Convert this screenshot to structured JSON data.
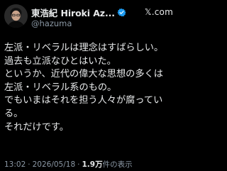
{
  "author": {
    "display_name": "東浩紀 Hiroki Az...",
    "handle": "@hazuma",
    "verified": true,
    "avatar_icon": "avatar-portrait-icon"
  },
  "brand": {
    "text": "𝕏.com",
    "icon": "x-logo-icon"
  },
  "post": {
    "lines": [
      "左派・リベラルは理念はすばらしい。",
      "過去も立派なひとはいた。",
      "というか、近代の偉大な思想の多くは",
      "左派・リベラル系のもの。",
      "でもいまはそれを担う人々が腐ってい",
      "る。",
      "それだけです。"
    ]
  },
  "meta": {
    "time": "13:02",
    "separator_1": "·",
    "date": "2026/05/18",
    "separator_2": "·",
    "views_count": "1.9万",
    "views_label": "件の表示"
  },
  "colors": {
    "background": "#000000",
    "text": "#e7e9ea",
    "secondary": "#8b98a5",
    "verified_badge": "#1d9bf0"
  }
}
